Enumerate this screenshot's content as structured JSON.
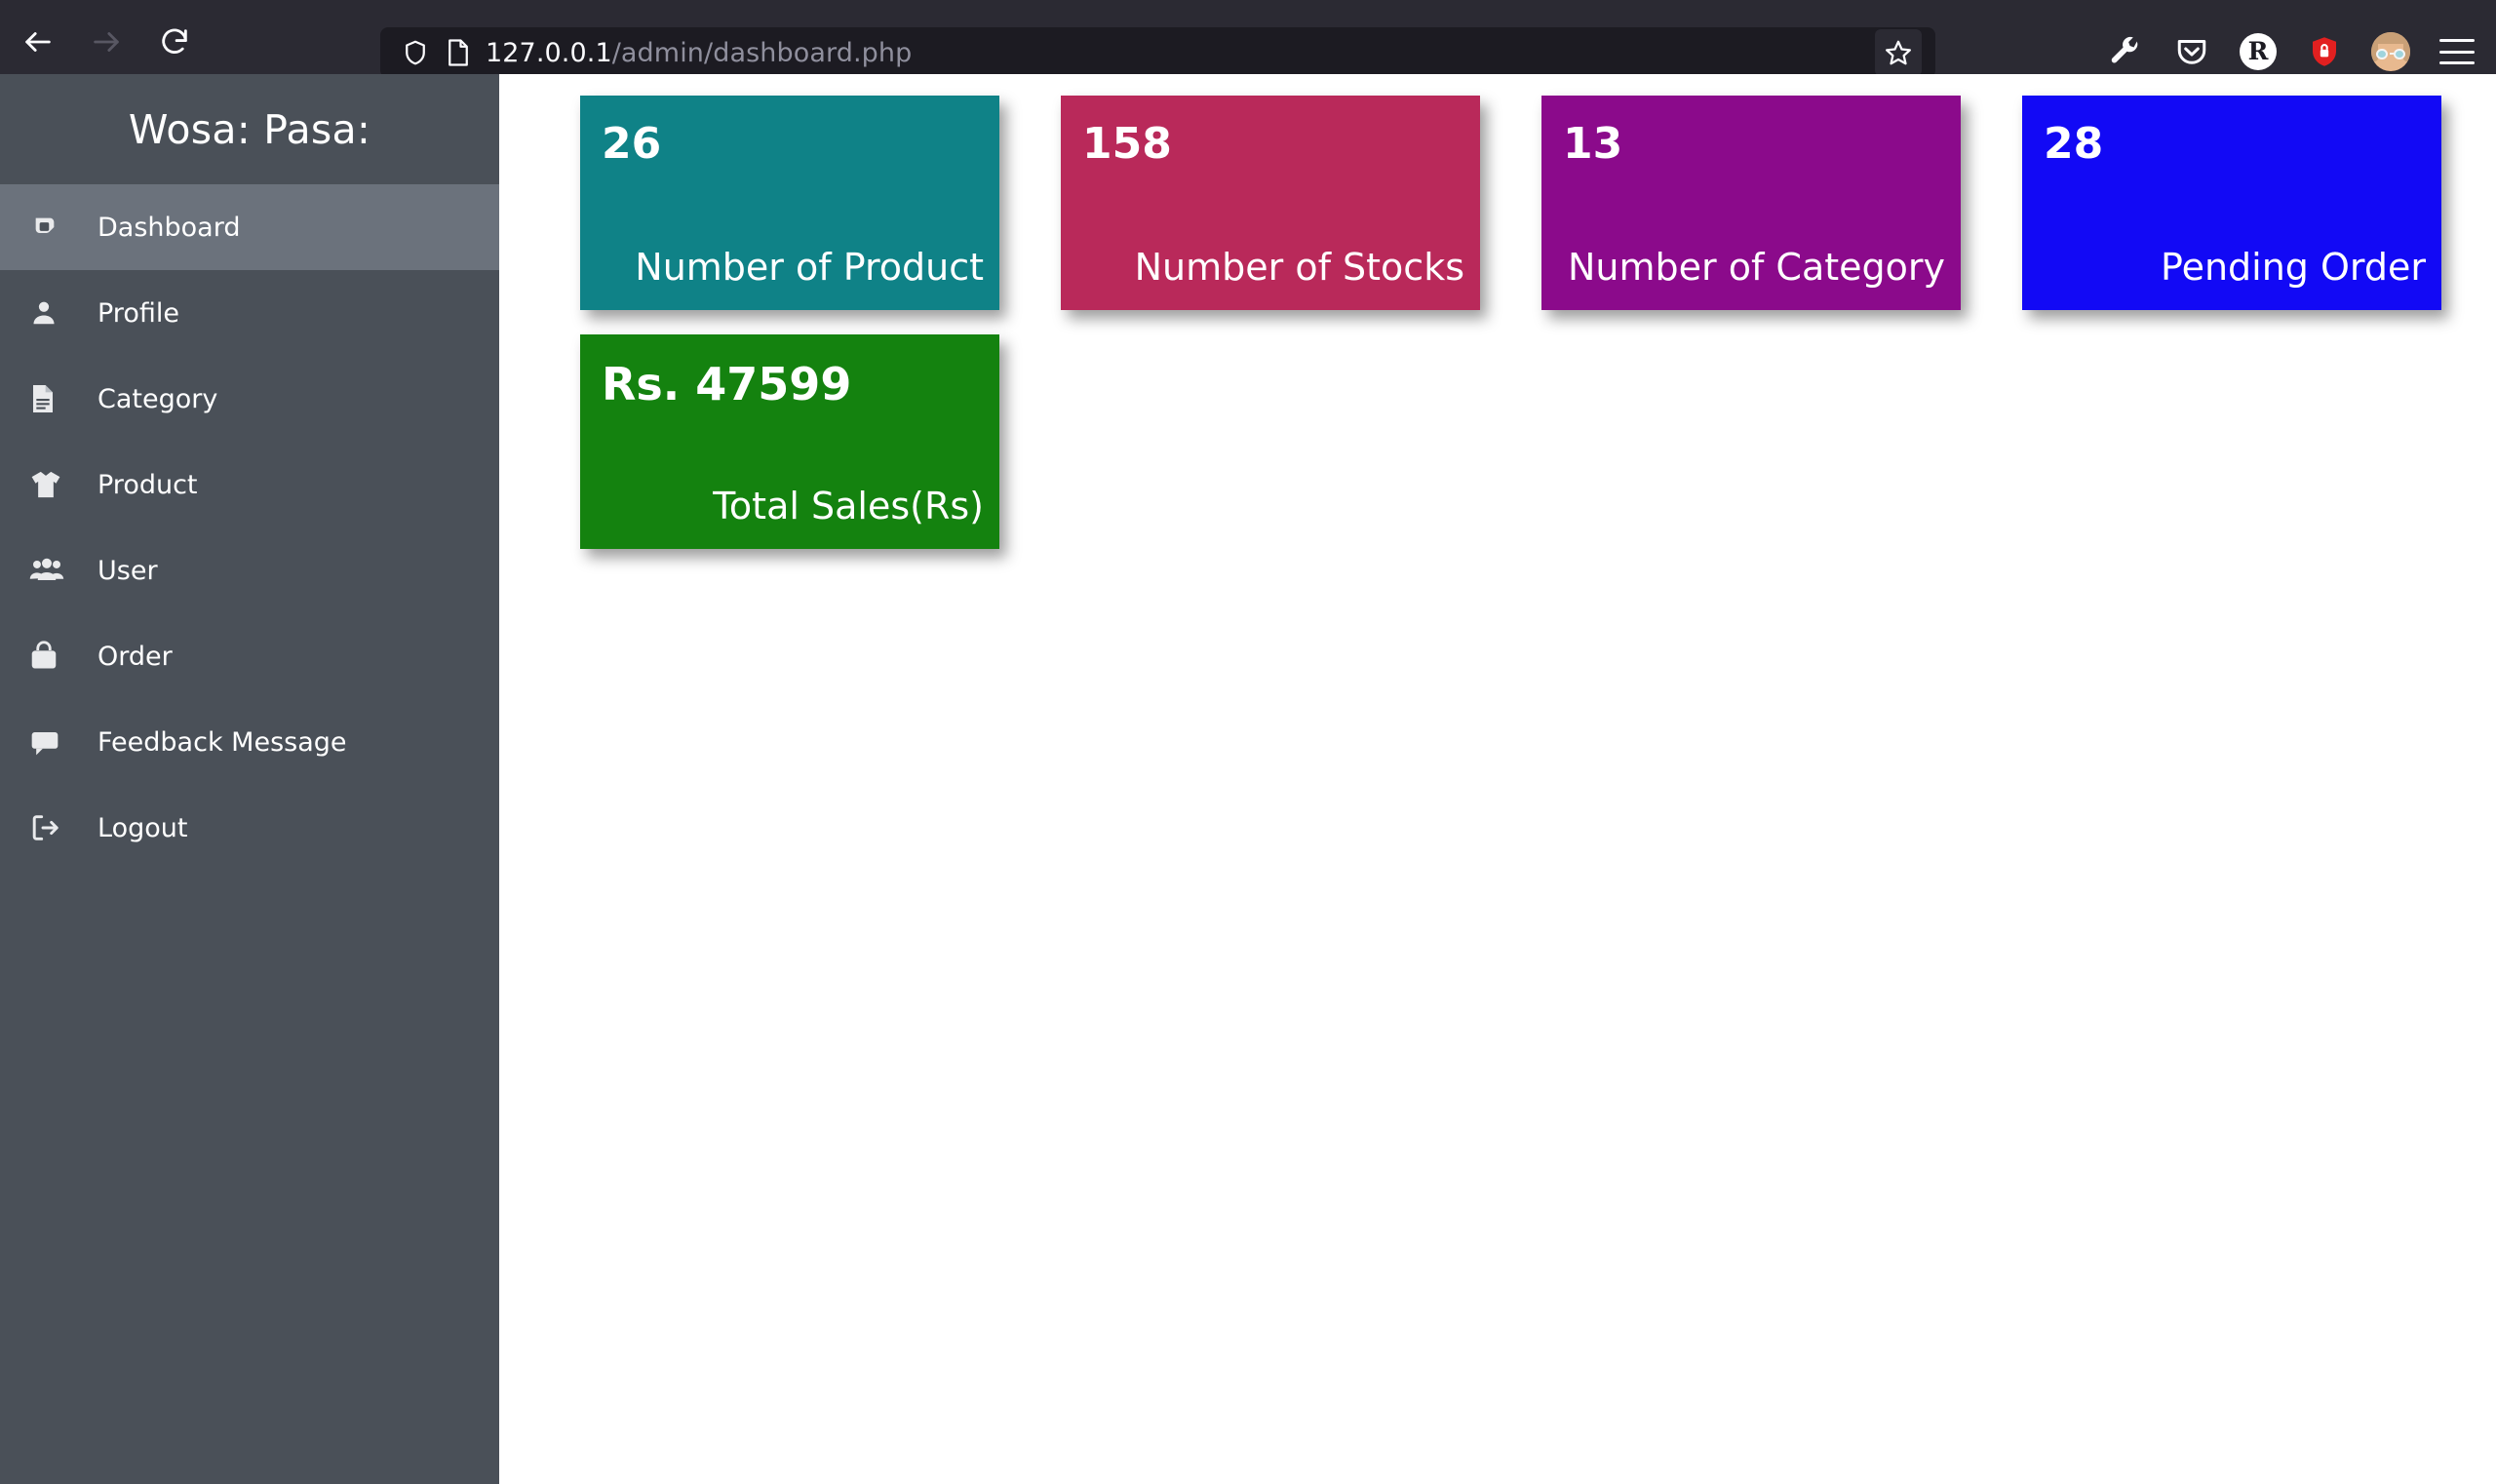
{
  "browser": {
    "back_icon": "back-arrow-icon",
    "forward_icon": "forward-arrow-icon",
    "reload_icon": "reload-icon",
    "shield_icon": "tracking-protection-shield-icon",
    "page_icon": "page-document-icon",
    "url_host": "127.0.0.1",
    "url_path": "/admin/dashboard.php",
    "url_full": "127.0.0.1/admin/dashboard.php",
    "bookmark_icon": "bookmark-star-icon",
    "toolbar_icons": [
      {
        "name": "wrench-icon",
        "label": ""
      },
      {
        "name": "pocket-icon",
        "label": ""
      },
      {
        "name": "rakuten-icon",
        "label": "R"
      },
      {
        "name": "shield-lock-icon",
        "label": ""
      },
      {
        "name": "account-avatar-icon",
        "label": ""
      },
      {
        "name": "hamburger-menu-icon",
        "label": ""
      }
    ]
  },
  "sidebar": {
    "brand": "Wosa: Pasa:",
    "items": [
      {
        "label": "Dashboard",
        "icon": "dashboard-icon",
        "active": true
      },
      {
        "label": "Profile",
        "icon": "user-icon",
        "active": false
      },
      {
        "label": "Category",
        "icon": "file-lines-icon",
        "active": false
      },
      {
        "label": "Product",
        "icon": "tshirt-icon",
        "active": false
      },
      {
        "label": "User",
        "icon": "users-icon",
        "active": false
      },
      {
        "label": "Order",
        "icon": "shopping-bag-icon",
        "active": false
      },
      {
        "label": "Feedback Message",
        "icon": "comment-icon",
        "active": false
      },
      {
        "label": "Logout",
        "icon": "sign-out-icon",
        "active": false
      }
    ]
  },
  "dashboard": {
    "cards": [
      {
        "value": "26",
        "caption": "Number of Product",
        "color": "#0f8287"
      },
      {
        "value": "158",
        "caption": "Number of Stocks",
        "color": "#b9295a"
      },
      {
        "value": "13",
        "caption": "Number of Category",
        "color": "#8b0a8b"
      },
      {
        "value": "28",
        "caption": "Pending Order",
        "color": "#1209f5"
      }
    ],
    "sales_card": {
      "value": "Rs. 47599",
      "caption": "Total Sales(Rs)",
      "color": "#14820f"
    }
  }
}
